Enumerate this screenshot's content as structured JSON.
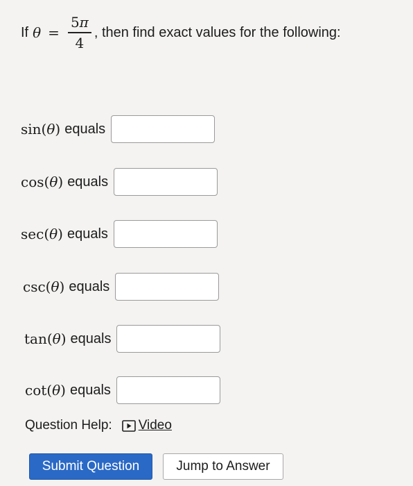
{
  "question": {
    "prefix": "If",
    "variable": "θ",
    "equals_sign": "=",
    "numerator": "5",
    "numerator_symbol": "π",
    "denominator": "4",
    "suffix": ", then find exact values for the following:"
  },
  "rows": [
    {
      "func": "sin",
      "arg": "θ",
      "label": "equals",
      "value": ""
    },
    {
      "func": "cos",
      "arg": "θ",
      "label": "equals",
      "value": ""
    },
    {
      "func": "sec",
      "arg": "θ",
      "label": "equals",
      "value": ""
    },
    {
      "func": "csc",
      "arg": "θ",
      "label": "equals",
      "value": ""
    },
    {
      "func": "tan",
      "arg": "θ",
      "label": "equals",
      "value": ""
    },
    {
      "func": "cot",
      "arg": "θ",
      "label": "equals",
      "value": ""
    }
  ],
  "help": {
    "label": "Question Help:",
    "video_label": "Video",
    "video_icon": "play-icon"
  },
  "buttons": {
    "submit": "Submit Question",
    "jump": "Jump to Answer"
  },
  "colors": {
    "background": "#f4f3f1",
    "submit_bg": "#2a69c6",
    "input_border": "#9a9a9a"
  }
}
